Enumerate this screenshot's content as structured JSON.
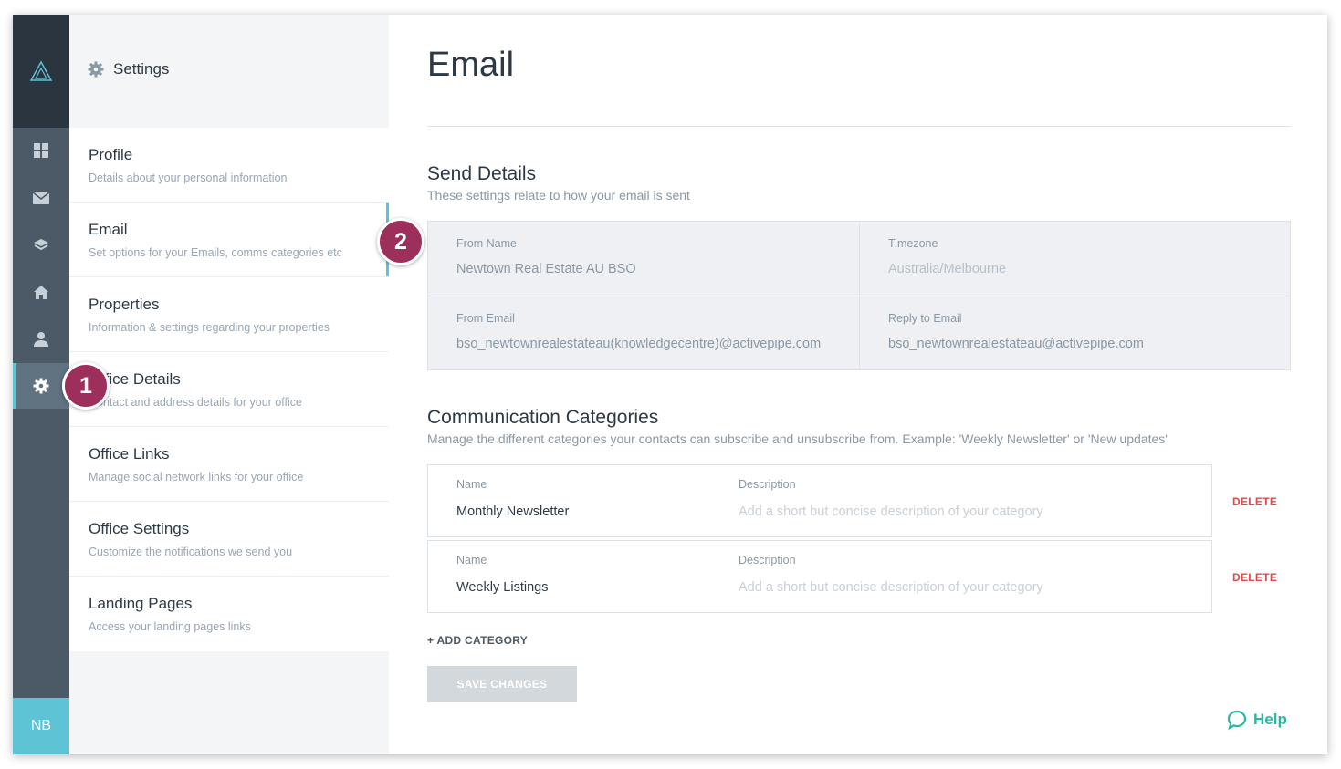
{
  "colors": {
    "accent": "#5fc3d6",
    "rail": "#4b5a66",
    "rail_dark": "#2b3540",
    "danger": "#e04a4a",
    "badge": "#9c2f5c",
    "help": "#2cb7a4"
  },
  "rail": {
    "logo_icon": "triangle-logo-icon",
    "items": [
      {
        "icon": "dashboard-grid-icon"
      },
      {
        "icon": "envelope-icon"
      },
      {
        "icon": "layers-icon"
      },
      {
        "icon": "home-icon"
      },
      {
        "icon": "user-icon"
      },
      {
        "icon": "gear-icon",
        "active": true
      }
    ],
    "avatar_initials": "NB"
  },
  "nav": {
    "header": "Settings",
    "items": [
      {
        "title": "Profile",
        "desc": "Details about your personal information"
      },
      {
        "title": "Email",
        "desc": "Set options for your Emails, comms categories etc",
        "active": true
      },
      {
        "title": "Properties",
        "desc": "Information & settings regarding your properties"
      },
      {
        "title": "Office Details",
        "desc": "Contact and address details for your office"
      },
      {
        "title": "Office Links",
        "desc": "Manage social network links for your office"
      },
      {
        "title": "Office Settings",
        "desc": "Customize the notifications we send you"
      },
      {
        "title": "Landing Pages",
        "desc": "Access your landing pages links"
      }
    ]
  },
  "main": {
    "title": "Email",
    "send_details": {
      "title": "Send Details",
      "subtitle": "These settings relate to how your email is sent",
      "from_name_label": "From Name",
      "from_name_value": "Newtown Real Estate AU BSO",
      "timezone_label": "Timezone",
      "timezone_value": "Australia/Melbourne",
      "from_email_label": "From Email",
      "from_email_value": "bso_newtownrealestateau(knowledgecentre)@activepipe.com",
      "reply_email_label": "Reply to Email",
      "reply_email_value": "bso_newtownrealestateau@activepipe.com"
    },
    "categories": {
      "title": "Communication Categories",
      "subtitle": "Manage the different categories your contacts can subscribe and unsubscribe from. Example: 'Weekly Newsletter' or 'New updates'",
      "rows": [
        {
          "name_label": "Name",
          "name": "Monthly Newsletter",
          "desc_label": "Description",
          "desc_placeholder": "Add a short but concise description of your category",
          "delete_label": "DELETE"
        },
        {
          "name_label": "Name",
          "name": "Weekly Listings",
          "desc_label": "Description",
          "desc_placeholder": "Add a short but concise description of your category",
          "delete_label": "DELETE"
        }
      ],
      "add_label": "+ ADD CATEGORY"
    },
    "save_label": "SAVE CHANGES",
    "help_label": "Help"
  },
  "badges": [
    "1",
    "2"
  ]
}
